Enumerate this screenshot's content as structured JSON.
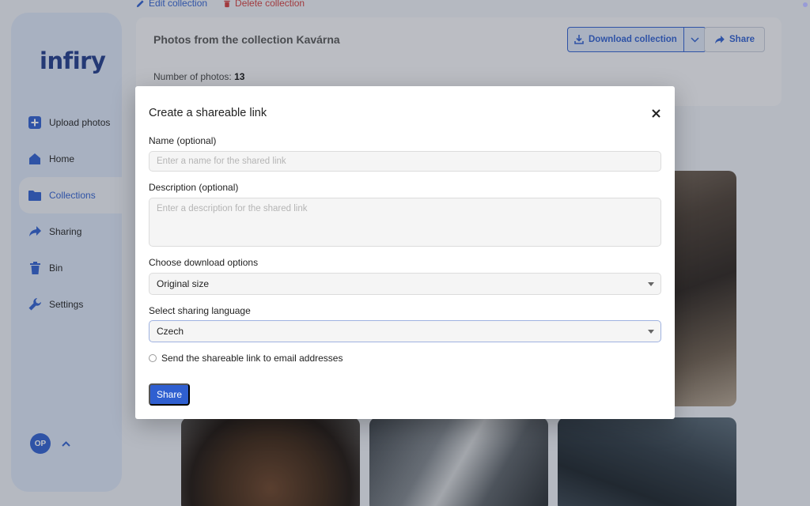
{
  "topbar": {
    "edit_label": "Edit collection",
    "delete_label": "Delete collection"
  },
  "sidebar": {
    "logo": "infiry",
    "items": [
      {
        "label": "Upload photos",
        "icon": "plus-square-icon"
      },
      {
        "label": "Home",
        "icon": "home-icon"
      },
      {
        "label": "Collections",
        "icon": "folder-icon",
        "active": true
      },
      {
        "label": "Sharing",
        "icon": "share-arrow-icon"
      },
      {
        "label": "Bin",
        "icon": "trash-icon"
      },
      {
        "label": "Settings",
        "icon": "wrench-icon"
      }
    ],
    "user_initials": "OP"
  },
  "header": {
    "title": "Photos from the collection Kavárna",
    "count_label": "Number of photos:",
    "count_value": "13",
    "download_label": "Download collection",
    "share_label": "Share"
  },
  "modal": {
    "title": "Create a shareable link",
    "name_label": "Name (optional)",
    "name_placeholder": "Enter a name for the shared link",
    "name_value": "",
    "description_label": "Description (optional)",
    "description_placeholder": "Enter a description for the shared link",
    "description_value": "",
    "download_options_label": "Choose download options",
    "download_option_selected": "Original size",
    "language_label": "Select sharing language",
    "language_selected": "Czech",
    "email_option_label": "Send the shareable link to email addresses",
    "email_option_checked": false,
    "submit_label": "Share"
  },
  "colors": {
    "accent": "#2f5fd0",
    "danger": "#d23b3b",
    "sidebar_bg": "#dbe5f6"
  }
}
